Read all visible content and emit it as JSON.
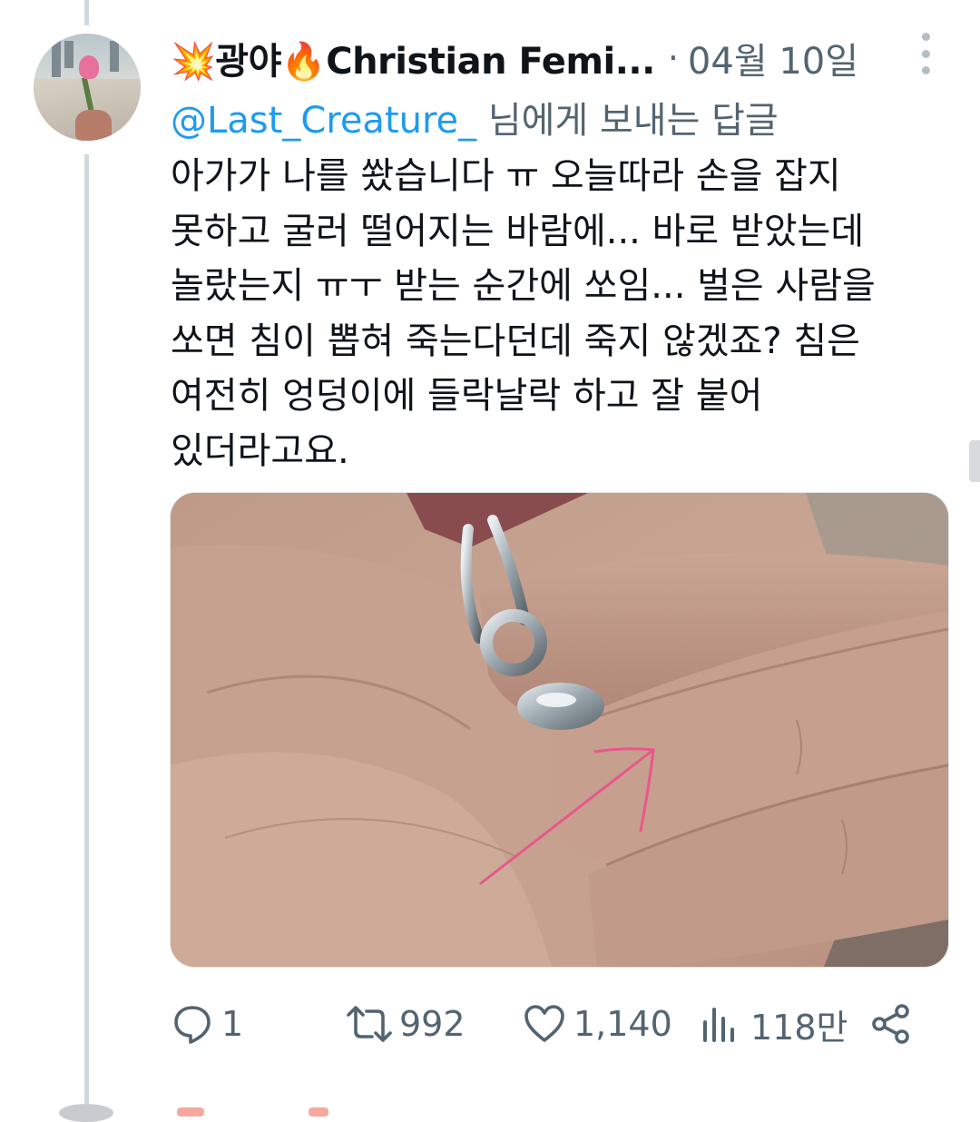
{
  "tweet": {
    "author_name": "💥광야🔥Christian Femi...",
    "separator": "·",
    "date": "04월 10일",
    "reply_to_handle": "@Last_Creature_",
    "reply_to_suffix": " 님에게 보내는 답글",
    "text_lines": [
      "아가가 나를 쐈습니다 ㅠ 오늘따라 손을 잡지",
      "못하고 굴러 떨어지는 바람에... 바로 받았는데",
      "놀랐는지 ㅠㅜ 받는 순간에 쏘임... 벌은 사람을",
      "쏘면 침이 뽑혀 죽는다던데 죽지 않겠죠? 침은",
      "여전히 엉덩이에 들락날락 하고 잘 붙어",
      "있더라고요."
    ],
    "media_description_icon": "photo-hand-ring-arrow"
  },
  "actions": {
    "replies": "1",
    "retweets": "992",
    "likes": "1,140",
    "views": "118만"
  },
  "colors": {
    "text_primary": "#0f1419",
    "text_secondary": "#536471",
    "link": "#1d9bf0",
    "thread_line": "#cfd9de"
  }
}
